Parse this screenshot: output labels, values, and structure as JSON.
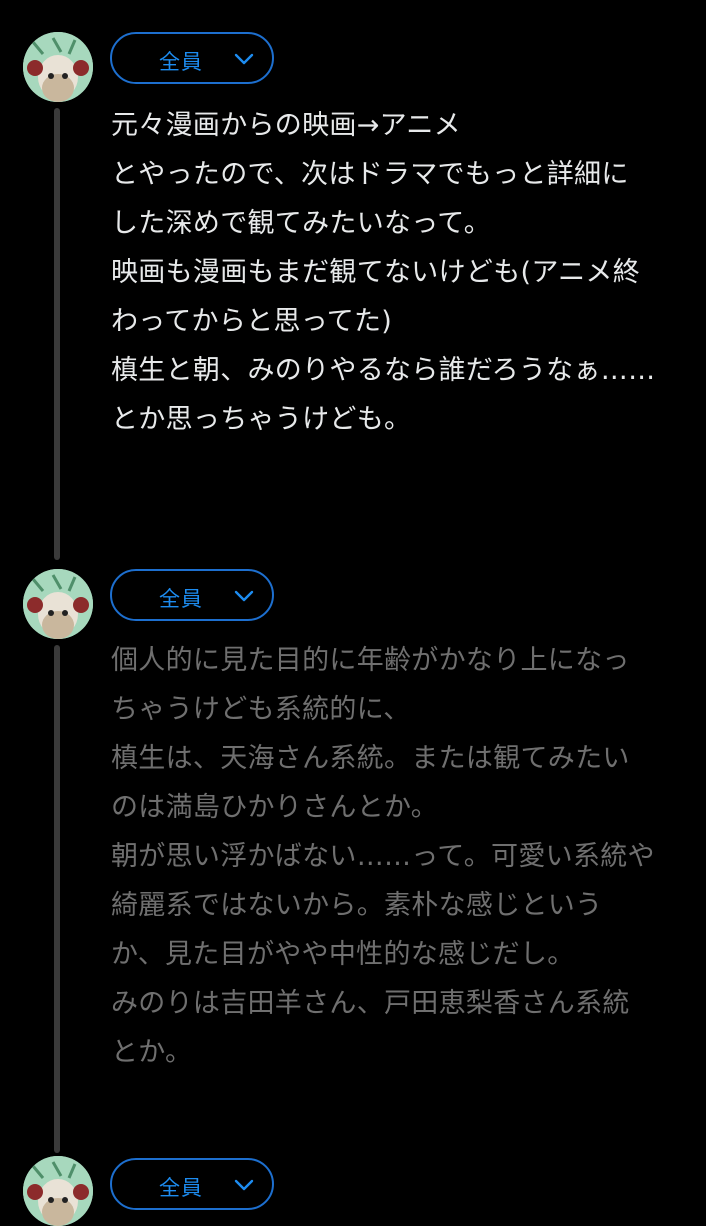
{
  "colors": {
    "background": "#000000",
    "accent": "#1d8cf0",
    "thread_line": "#3a3a3a",
    "primary_text": "#e7e9ea",
    "dimmed_text": "#6f6f6f"
  },
  "posts": [
    {
      "audience": {
        "label": "全員",
        "icon": "chevron-down-icon"
      },
      "avatar_icon": "frog-avatar",
      "lines": [
        "元々漫画からの映画→アニメ",
        "とやったので、次はドラマでもっと詳細に",
        "した深めで観てみたいなって。",
        "映画も漫画もまだ観てないけども(アニメ終",
        "わってからと思ってた)",
        "槙生と朝、みのりやるなら誰だろうなぁ……",
        "とか思っちゃうけども。"
      ]
    },
    {
      "audience": {
        "label": "全員",
        "icon": "chevron-down-icon"
      },
      "avatar_icon": "frog-avatar",
      "lines": [
        "個人的に見た目的に年齢がかなり上になっ",
        "ちゃうけども系統的に、",
        "槙生は、天海さん系統。または観てみたい",
        "のは満島ひかりさんとか。",
        "朝が思い浮かばない……って。可愛い系統や",
        "綺麗系ではないから。素朴な感じという",
        "か、見た目がやや中性的な感じだし。",
        "みのりは吉田羊さん、戸田恵梨香さん系統",
        "とか。"
      ]
    },
    {
      "audience": {
        "label": "全員",
        "icon": "chevron-down-icon"
      },
      "avatar_icon": "frog-avatar",
      "lines": []
    }
  ]
}
